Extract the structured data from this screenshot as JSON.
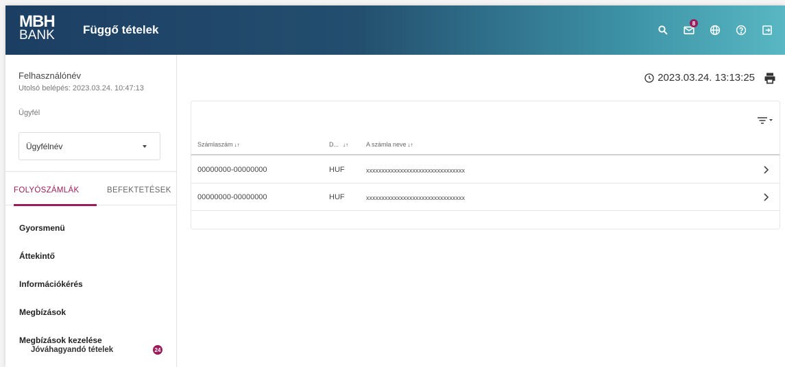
{
  "header": {
    "logo_line1": "MBH",
    "logo_line2": "BANK",
    "title": "Függő tételek",
    "icons": [
      "search-icon",
      "mail-icon",
      "globe-icon",
      "help-icon",
      "logout-icon"
    ],
    "mail_badge": "8"
  },
  "sidebar": {
    "username": "Felhasználónév",
    "last_login": "Utolsó belépés: 2023.03.24. 10:47:13",
    "client_label": "Ügyfél",
    "client_value": "Ügyfélnév",
    "tabs": [
      "FOLYÓSZÁMLÁK",
      "BEFEKTETÉSEK"
    ],
    "active_tab": "FOLYÓSZÁMLÁK",
    "menu": [
      "Gyorsmenü",
      "Áttekintő",
      "Információkérés",
      "Megbízások",
      "Megbízások kezelése"
    ],
    "submenu": {
      "label": "Jóváhagyandó tételek",
      "badge": "24"
    }
  },
  "main": {
    "timestamp": "2023.03.24. 13:13:25",
    "table": {
      "columns": [
        "Számlaszám",
        "D...",
        "A számla neve"
      ],
      "rows": [
        [
          "00000000-00000000",
          "HUF",
          "xxxxxxxxxxxxxxxxxxxxxxxxxxxxxxxx"
        ],
        [
          "00000000-00000000",
          "HUF",
          "xxxxxxxxxxxxxxxxxxxxxxxxxxxxxxxx"
        ]
      ]
    }
  },
  "colors": {
    "accent": "#9b1c5a",
    "header_start": "#1c3e63",
    "header_end": "#58b7c2"
  }
}
